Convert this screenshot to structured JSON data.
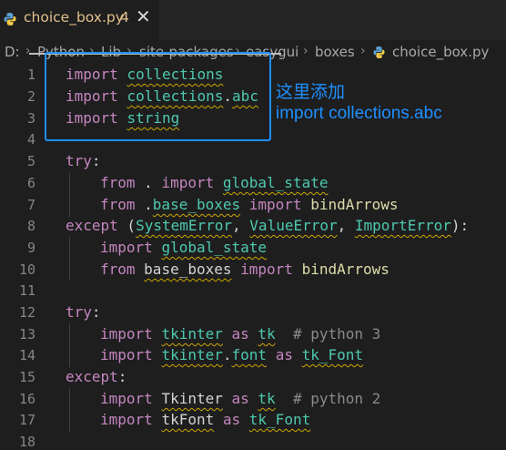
{
  "tab": {
    "filename": "choice_box.py",
    "badge": "4",
    "close_glyph": "✕"
  },
  "breadcrumb": {
    "items": [
      "D:",
      "Python",
      "Lib",
      "site-packages",
      "easygui",
      "boxes",
      "choice_box.py"
    ],
    "separator": "›"
  },
  "lines": [
    {
      "n": "1"
    },
    {
      "n": "2"
    },
    {
      "n": "3"
    },
    {
      "n": "4"
    },
    {
      "n": "5"
    },
    {
      "n": "6"
    },
    {
      "n": "7"
    },
    {
      "n": "8"
    },
    {
      "n": "9"
    },
    {
      "n": "10"
    },
    {
      "n": "11"
    },
    {
      "n": "12"
    },
    {
      "n": "13"
    },
    {
      "n": "14"
    },
    {
      "n": "15"
    },
    {
      "n": "16"
    },
    {
      "n": "17"
    },
    {
      "n": "18"
    }
  ],
  "code": {
    "l1": [
      "import",
      "collections"
    ],
    "l2": [
      "import",
      "collections",
      ".",
      "abc"
    ],
    "l3": [
      "import",
      "string"
    ],
    "l5": [
      "try",
      ":"
    ],
    "l6": [
      "from",
      " . ",
      "import",
      "global_state"
    ],
    "l7": [
      "from",
      " .",
      "base_boxes",
      "import",
      "bindArrows"
    ],
    "l8": [
      "except",
      " (",
      "SystemError",
      ", ",
      "ValueError",
      ", ",
      "ImportError",
      "):"
    ],
    "l9": [
      "import",
      "global_state"
    ],
    "l10": [
      "from",
      "base_boxes",
      "import",
      "bindArrows"
    ],
    "l12": [
      "try",
      ":"
    ],
    "l13": [
      "import",
      "tkinter",
      "as",
      "tk",
      "# python 3"
    ],
    "l14": [
      "import",
      "tkinter",
      ".",
      "font",
      "as",
      "tk_Font"
    ],
    "l15": [
      "except",
      ":"
    ],
    "l16": [
      "import",
      "Tkinter",
      "as",
      "tk",
      "# python 2"
    ],
    "l17": [
      "import",
      "tkFont",
      "as",
      "tk_Font"
    ]
  },
  "annotation": {
    "line1": "这里添加",
    "line2": "import collections.abc",
    "color": "#1e90ff"
  },
  "colors": {
    "keyword": "#c586c0",
    "module": "#4ec9b0",
    "function": "#dcdcaa",
    "comment": "#6a9955",
    "tab_modified": "#e2c08d"
  }
}
